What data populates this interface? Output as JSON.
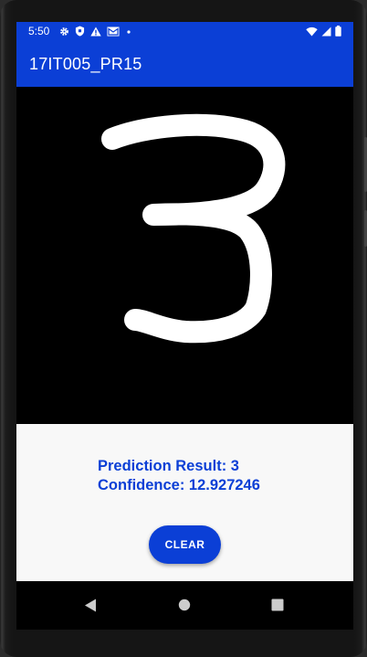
{
  "status_bar": {
    "time": "5:50",
    "left_icons": [
      "gear-icon",
      "shield-icon",
      "warning-icon",
      "mail-icon",
      "dot-icon"
    ],
    "right_icons": [
      "wifi-icon",
      "signal-icon",
      "battery-icon"
    ]
  },
  "app_bar": {
    "title": "17IT005_PR15"
  },
  "canvas": {
    "drawn_digit": "3",
    "background": "#000000",
    "stroke_color": "#ffffff"
  },
  "result": {
    "prediction_line": "Prediction Result: 3",
    "confidence_line": "Confidence: 12.927246"
  },
  "actions": {
    "clear_label": "CLEAR"
  },
  "nav_bar": {
    "items": [
      "back-icon",
      "home-icon",
      "recents-icon"
    ]
  },
  "colors": {
    "accent": "#0b3fd6",
    "panel_bg": "#f8f8f8"
  }
}
